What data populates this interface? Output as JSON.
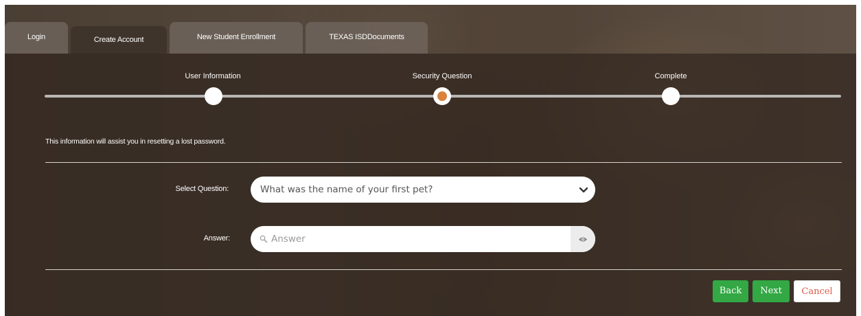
{
  "tabs": [
    {
      "label": "Login",
      "active": false
    },
    {
      "label": "Create Account",
      "active": true
    },
    {
      "label": "New Student Enrollment",
      "active": false
    },
    {
      "label": "TEXAS ISDDocuments",
      "active": false
    }
  ],
  "steps": [
    {
      "label": "User Information",
      "state": "done"
    },
    {
      "label": "Security Question",
      "state": "current"
    },
    {
      "label": "Complete",
      "state": "pending"
    }
  ],
  "info_text": "This information will assist you in resetting a lost password.",
  "form": {
    "question_label": "Select Question:",
    "question_value": "What was the name of your first pet?",
    "answer_label": "Answer:",
    "answer_placeholder": "Answer",
    "answer_value": ""
  },
  "buttons": {
    "back": "Back",
    "next": "Next",
    "cancel": "Cancel"
  },
  "colors": {
    "accent_green": "#33a845",
    "current_step_orange": "#d9823d",
    "cancel_text": "#e05a4a"
  },
  "icons": {
    "select_chevron": "chevron-down-icon",
    "answer_search": "search-icon",
    "answer_reveal": "eye-icon"
  }
}
